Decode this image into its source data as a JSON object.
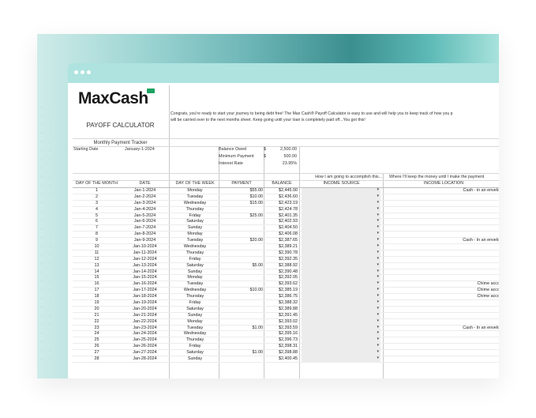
{
  "window": {
    "controls": [
      "dot",
      "dot",
      "dot"
    ]
  },
  "brand": {
    "logo_text": "MaxCash",
    "calculator_title": "PAYOFF CALCULATOR"
  },
  "intro": {
    "line1": "Congrats, you're ready to start your journey to being debt free! The Max Cash® Payoff Calculator is easy to use and will help you to keep track of how you p",
    "line2": "will be carried over to the next months sheet. Keep going until your loan is completely paid off...You got this!"
  },
  "tracker": {
    "title": "Monthly Payment Tracker",
    "starting_date_label": "Starting Date",
    "starting_date_value": "January-1-2024"
  },
  "summary": [
    {
      "label": "Balance Owed",
      "currency": "$",
      "value": "2,500.00"
    },
    {
      "label": "Minimum Payment",
      "currency": "$",
      "value": "500.00"
    },
    {
      "label": "Interest Rate",
      "currency": "",
      "value": "23.95%"
    }
  ],
  "questions": {
    "source_question": "How I am going to accomplish this...",
    "location_question": "Where I'll keep the money until I make the payment"
  },
  "columns": [
    "DAY OF THE MONTH",
    "DATE",
    "DAY OF THE WEEK",
    "PAYMENT",
    "BALANCE",
    "INCOME SOURCE",
    "INCOME LOCATION"
  ],
  "rows": [
    {
      "day": "1",
      "date": "Jan-1-2024",
      "dow": "Monday",
      "payment": "$55.00",
      "balance": "$2,445.00",
      "location": "Cash - in an envelop"
    },
    {
      "day": "2",
      "date": "Jan-2-2024",
      "dow": "Tuesday",
      "payment": "$10.00",
      "balance": "$2,436.60",
      "location": ""
    },
    {
      "day": "3",
      "date": "Jan-3-2024",
      "dow": "Wednesday",
      "payment": "$15.00",
      "balance": "$2,423.19",
      "location": ""
    },
    {
      "day": "4",
      "date": "Jan-4-2024",
      "dow": "Thursday",
      "payment": "",
      "balance": "$2,424.78",
      "location": ""
    },
    {
      "day": "5",
      "date": "Jan-5-2024",
      "dow": "Friday",
      "payment": "$25.00",
      "balance": "$2,401.35",
      "location": ""
    },
    {
      "day": "6",
      "date": "Jan-6-2024",
      "dow": "Saturday",
      "payment": "",
      "balance": "$2,402.93",
      "location": ""
    },
    {
      "day": "7",
      "date": "Jan-7-2024",
      "dow": "Sunday",
      "payment": "",
      "balance": "$2,404.50",
      "location": ""
    },
    {
      "day": "8",
      "date": "Jan-8-2024",
      "dow": "Monday",
      "payment": "",
      "balance": "$2,406.08",
      "location": ""
    },
    {
      "day": "9",
      "date": "Jan-9-2024",
      "dow": "Tuesday",
      "payment": "$20.00",
      "balance": "$2,387.65",
      "location": "Cash - In an envelop"
    },
    {
      "day": "10",
      "date": "Jan-10-2024",
      "dow": "Wednesday",
      "payment": "",
      "balance": "$2,389.21",
      "location": ""
    },
    {
      "day": "11",
      "date": "Jan-11-2024",
      "dow": "Thursday",
      "payment": "",
      "balance": "$2,390.78",
      "location": ""
    },
    {
      "day": "12",
      "date": "Jan-12-2024",
      "dow": "Friday",
      "payment": "",
      "balance": "$2,392.35",
      "location": ""
    },
    {
      "day": "13",
      "date": "Jan-13-2024",
      "dow": "Saturday",
      "payment": "$5.00",
      "balance": "$2,388.92",
      "location": ""
    },
    {
      "day": "14",
      "date": "Jan-14-2024",
      "dow": "Sunday",
      "payment": "",
      "balance": "$2,390.48",
      "location": ""
    },
    {
      "day": "15",
      "date": "Jan-15-2024",
      "dow": "Monday",
      "payment": "",
      "balance": "$2,392.05",
      "location": ""
    },
    {
      "day": "16",
      "date": "Jan-16-2024",
      "dow": "Tuesday",
      "payment": "",
      "balance": "$2,393.62",
      "location": "Chime accou"
    },
    {
      "day": "17",
      "date": "Jan-17-2024",
      "dow": "Wednesday",
      "payment": "$10.00",
      "balance": "$2,385.19",
      "location": "Chime accou"
    },
    {
      "day": "18",
      "date": "Jan-18-2024",
      "dow": "Thursday",
      "payment": "",
      "balance": "$2,386.75",
      "location": "Chime accou"
    },
    {
      "day": "19",
      "date": "Jan-19-2024",
      "dow": "Friday",
      "payment": "",
      "balance": "$2,388.32",
      "location": ""
    },
    {
      "day": "20",
      "date": "Jan-20-2024",
      "dow": "Saturday",
      "payment": "",
      "balance": "$2,389.88",
      "location": ""
    },
    {
      "day": "21",
      "date": "Jan-21-2024",
      "dow": "Sunday",
      "payment": "",
      "balance": "$2,391.45",
      "location": ""
    },
    {
      "day": "22",
      "date": "Jan-22-2024",
      "dow": "Monday",
      "payment": "",
      "balance": "$2,393.02",
      "location": ""
    },
    {
      "day": "23",
      "date": "Jan-23-2024",
      "dow": "Tuesday",
      "payment": "$1.00",
      "balance": "$2,393.59",
      "location": "Cash - In an envelop"
    },
    {
      "day": "24",
      "date": "Jan-24-2024",
      "dow": "Wednesday",
      "payment": "",
      "balance": "$2,395.16",
      "location": ""
    },
    {
      "day": "25",
      "date": "Jan-25-2024",
      "dow": "Thursday",
      "payment": "",
      "balance": "$2,396.73",
      "location": ""
    },
    {
      "day": "26",
      "date": "Jan-26-2024",
      "dow": "Friday",
      "payment": "",
      "balance": "$2,398.31",
      "location": ""
    },
    {
      "day": "27",
      "date": "Jan-27-2024",
      "dow": "Saturday",
      "payment": "$1.00",
      "balance": "$2,398.88",
      "location": ""
    },
    {
      "day": "28",
      "date": "Jan-28-2024",
      "dow": "Sunday",
      "payment": "",
      "balance": "$2,400.45",
      "location": ""
    }
  ],
  "icons": {
    "dropdown": "▾"
  },
  "colors": {
    "brand_green": "#1aa262",
    "titlebar": "#aee3df",
    "dropdown_bg": "#ececec"
  }
}
